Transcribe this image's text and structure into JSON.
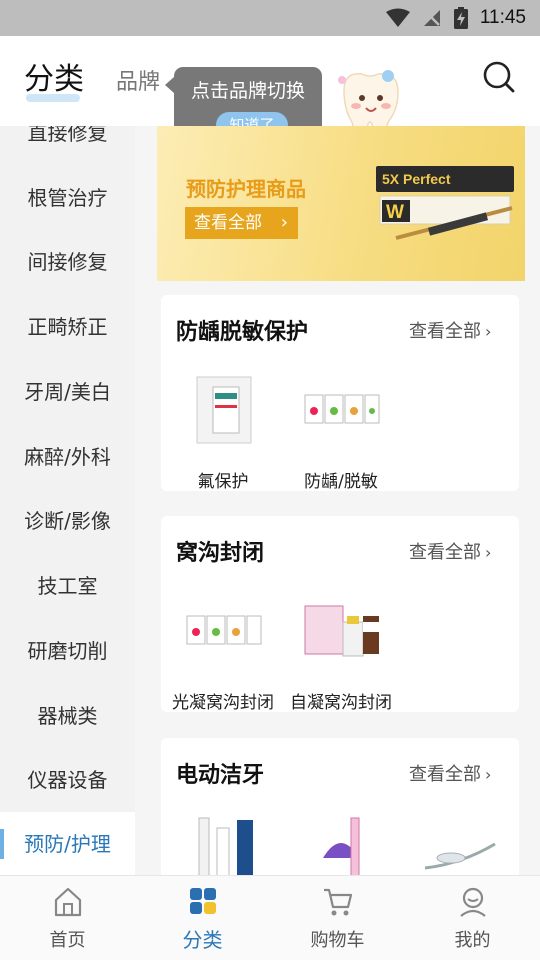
{
  "status_bar": {
    "time": "11:45"
  },
  "header": {
    "tab_active": "分类",
    "tab_inactive": "品牌"
  },
  "tooltip": {
    "text": "点击品牌切换",
    "button": "知道了"
  },
  "sidebar": {
    "items": [
      {
        "label": "直接修复"
      },
      {
        "label": "根管治疗"
      },
      {
        "label": "间接修复"
      },
      {
        "label": "正畸矫正"
      },
      {
        "label": "牙周/美白"
      },
      {
        "label": "麻醉/外科"
      },
      {
        "label": "诊断/影像"
      },
      {
        "label": "技工室"
      },
      {
        "label": "研磨切削"
      },
      {
        "label": "器械类"
      },
      {
        "label": "仪器设备"
      },
      {
        "label": "预防/护理",
        "active": true
      }
    ]
  },
  "banner": {
    "title": "预防护理商品",
    "button": "查看全部",
    "product_text": "5X Perfect"
  },
  "sections": [
    {
      "title": "防龋脱敏保护",
      "more": "查看全部",
      "products": [
        {
          "label": "氟保护"
        },
        {
          "label": "防龋/脱敏"
        }
      ]
    },
    {
      "title": "窝沟封闭",
      "more": "查看全部",
      "products": [
        {
          "label": "光凝窝沟封闭"
        },
        {
          "label": "自凝窝沟封闭"
        }
      ]
    },
    {
      "title": "电动洁牙",
      "more": "查看全部",
      "products": [
        {
          "label": ""
        },
        {
          "label": ""
        },
        {
          "label": ""
        }
      ]
    }
  ],
  "bottom_nav": {
    "items": [
      {
        "label": "首页",
        "icon": "home-icon"
      },
      {
        "label": "分类",
        "icon": "category-icon",
        "active": true
      },
      {
        "label": "购物车",
        "icon": "cart-icon"
      },
      {
        "label": "我的",
        "icon": "profile-icon"
      }
    ]
  },
  "colors": {
    "accent": "#2a78b8",
    "tab_underline": "#cfe6f7",
    "banner_button": "#e6a51c",
    "banner_title": "#e79c1a"
  }
}
